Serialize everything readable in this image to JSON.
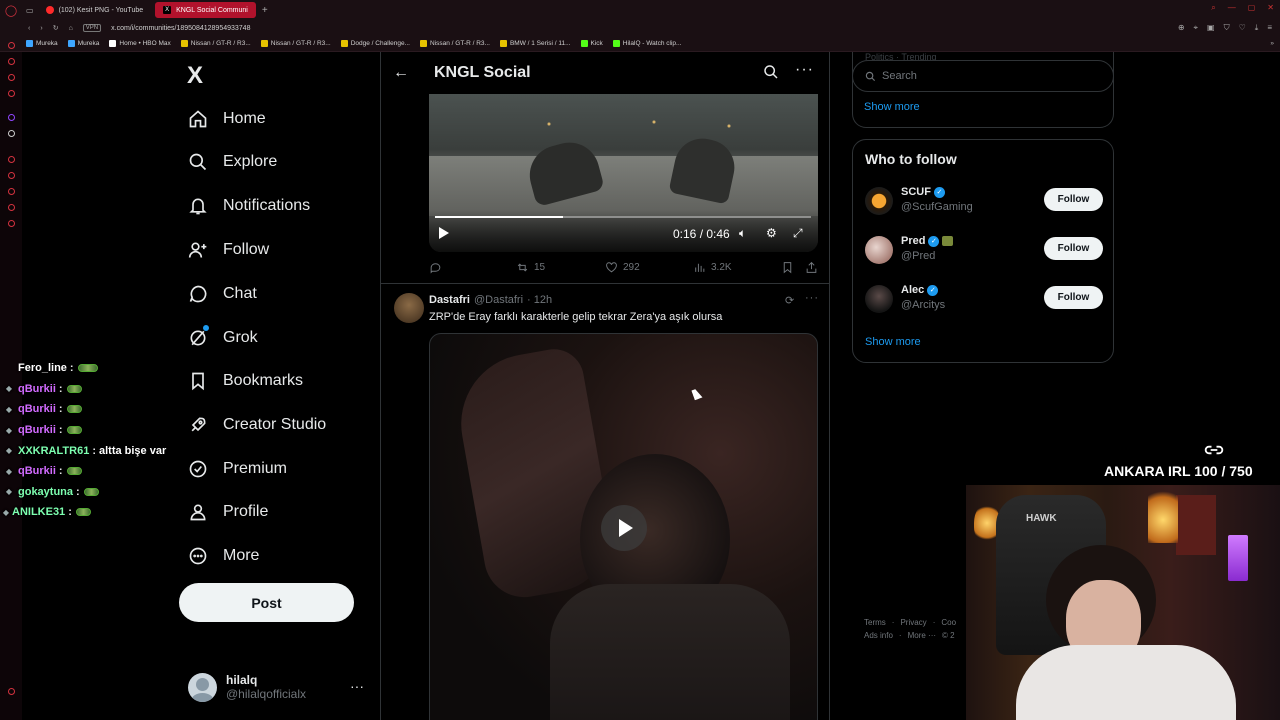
{
  "browser": {
    "tabs": [
      {
        "label": "(102) Kesit PNG - YouTube",
        "active": false
      },
      {
        "label": "KNGL Social Communi",
        "active": true
      }
    ],
    "url": "x.com/i/communities/1895084128954933748",
    "vpn": "VPN",
    "bookmarks": [
      "Mureka",
      "Mureka",
      "Home • HBO Max",
      "Nissan / GT-R / R3...",
      "Nissan / GT-R / R3...",
      "Dodge / Challenge...",
      "Nissan / GT-R / R3...",
      "BMW / 1 Serisi / 11...",
      "Kick",
      "HilalQ - Watch clip..."
    ]
  },
  "nav": {
    "logo": "X",
    "items": [
      {
        "key": "home",
        "label": "Home"
      },
      {
        "key": "explore",
        "label": "Explore"
      },
      {
        "key": "notifications",
        "label": "Notifications"
      },
      {
        "key": "follow",
        "label": "Follow"
      },
      {
        "key": "chat",
        "label": "Chat"
      },
      {
        "key": "grok",
        "label": "Grok"
      },
      {
        "key": "bookmarks",
        "label": "Bookmarks"
      },
      {
        "key": "creator-studio",
        "label": "Creator Studio"
      },
      {
        "key": "premium",
        "label": "Premium"
      },
      {
        "key": "profile",
        "label": "Profile"
      },
      {
        "key": "more",
        "label": "More"
      }
    ],
    "post_label": "Post",
    "account": {
      "name": "hilalq",
      "handle": "@hilalqofficialx",
      "menu": "···"
    }
  },
  "chat": [
    {
      "user": "Fero_line",
      "color": "#ffffff",
      "msg": ""
    },
    {
      "user": "qBurkii",
      "color": "#d16bff",
      "msg": ""
    },
    {
      "user": "qBurkii",
      "color": "#d16bff",
      "msg": ""
    },
    {
      "user": "qBurkii",
      "color": "#d16bff",
      "msg": ""
    },
    {
      "user": "XXKRALTR61",
      "color": "#7dffb0",
      "msg": "altta bişe var"
    },
    {
      "user": "qBurkii",
      "color": "#d16bff",
      "msg": ""
    },
    {
      "user": "gokaytuna",
      "color": "#7dffb0",
      "msg": ""
    },
    {
      "user": "ANILKE31",
      "color": "#7dffb0",
      "msg": ""
    }
  ],
  "community": {
    "title": "KNGL Social",
    "post1": {
      "video_time": "0:16 / 0:46",
      "progress_fraction": 0.34,
      "replies": "",
      "reposts": "15",
      "likes": "292",
      "views": "3.2K"
    },
    "post2": {
      "name": "Dastafri",
      "handle": "@Dastafri",
      "time": "· 12h",
      "text": "ZRP'de Eray farklı karakterle gelip tekrar Zera'ya aşık olursa"
    }
  },
  "sidebar": {
    "faded_text": "Politics · Trending",
    "search_placeholder": "Search",
    "show_more_1": "Show more",
    "who_to_follow": {
      "title": "Who to follow",
      "accounts": [
        {
          "name": "SCUF",
          "handle": "@ScufGaming",
          "button": "Follow",
          "avatar_color": "#e08a1e"
        },
        {
          "name": "Pred",
          "handle": "@Pred",
          "button": "Follow",
          "avatar_color": "#c9a6a0"
        },
        {
          "name": "Alec",
          "handle": "@Arcitys",
          "button": "Follow",
          "avatar_color": "#2a2a2a"
        }
      ],
      "show_more": "Show more"
    },
    "footer": [
      "Terms",
      "·",
      "Privacy",
      "·",
      "Coo",
      "Ads info",
      "·",
      "More ···",
      "© 2"
    ]
  },
  "overlay": {
    "irl_text": "ANKARA IRL 100 / 750",
    "webcam_chair_text": "HAWK"
  },
  "colors": {
    "accent": "#1d9bf0",
    "background": "#000000",
    "muted": "#71767b"
  }
}
